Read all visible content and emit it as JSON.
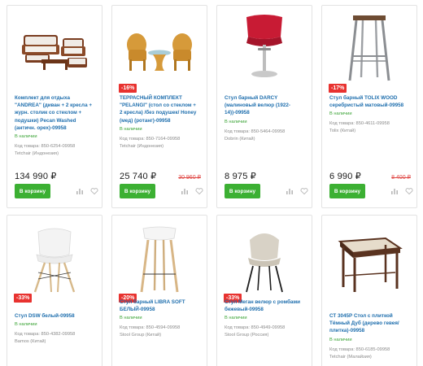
{
  "products": [
    {
      "title": "Комплект для отдыха \"ANDREA\" (диван + 2 кресла + журн. столик со стеклом + подушки) Pecan Washed (античн. орех)-09958",
      "badge": "",
      "stock": "В наличии",
      "code": "Код товара: 850-6254-09958",
      "brand": "Tetchair (Индонезия)",
      "price": "134 990 ₽",
      "old_price": "",
      "cart_label": "В корзину",
      "image_icon": "rattan-furniture-set"
    },
    {
      "title": "ТЕРРАСНЫЙ КОМПЛЕКТ \"PELANGI\" (стол со стеклом + 2 кресла) /без подушек/ Honey (мед) (ротанг)-09958",
      "badge": "-16%",
      "stock": "В наличии",
      "code": "Код товара: 850-7164-09958",
      "brand": "Tetchair (Индонезия)",
      "price": "25 740 ₽",
      "old_price": "30 960 ₽",
      "cart_label": "В корзину",
      "image_icon": "rattan-terrace-set"
    },
    {
      "title": "Стул барный DARCY (малиновый велюр (1922-14))-09958",
      "badge": "",
      "stock": "В наличии",
      "code": "Код товара: 850-5464-09958",
      "brand": "Dobrin (Китай)",
      "price": "8 975 ₽",
      "old_price": "",
      "cart_label": "В корзину",
      "image_icon": "red-bar-stool"
    },
    {
      "title": "Стул барный TOLIX WOOD серебристый матовый-09958",
      "badge": "-17%",
      "stock": "В наличии",
      "code": "Код товара: 850-4611-09958",
      "brand": "Tolix (Китай)",
      "price": "6 990 ₽",
      "old_price": "8 400 ₽",
      "cart_label": "В корзину",
      "image_icon": "metal-bar-stool"
    },
    {
      "title": "Стул DSW белый-09958",
      "badge": "-33%",
      "stock": "В наличии",
      "code": "Код товара: 850-4382-09958",
      "brand": "Bamos (Китай)",
      "image_icon": "white-chair"
    },
    {
      "title": "Стул барный LIBRA SOFT БЕЛЫЙ-09958",
      "badge": "-20%",
      "stock": "В наличии",
      "code": "Код товара: 850-4594-09958",
      "brand": "Stool Group (Китай)",
      "image_icon": "wooden-bar-stool"
    },
    {
      "title": "Стул Меган велюр с ромбами бежевый-09958",
      "badge": "-33%",
      "stock": "В наличии",
      "code": "Код товара: 850-4949-09958",
      "brand": "Stool Group (Россия)",
      "image_icon": "beige-velvet-chair"
    },
    {
      "title": "СТ 3045Р Стол с плиткой Тёмный Дуб (дерево гевея/плитка)-09958",
      "badge": "",
      "stock": "В наличии",
      "code": "Код товара: 850-6185-09958",
      "brand": "Tetchair (Малайзия)",
      "image_icon": "tile-top-table"
    }
  ]
}
